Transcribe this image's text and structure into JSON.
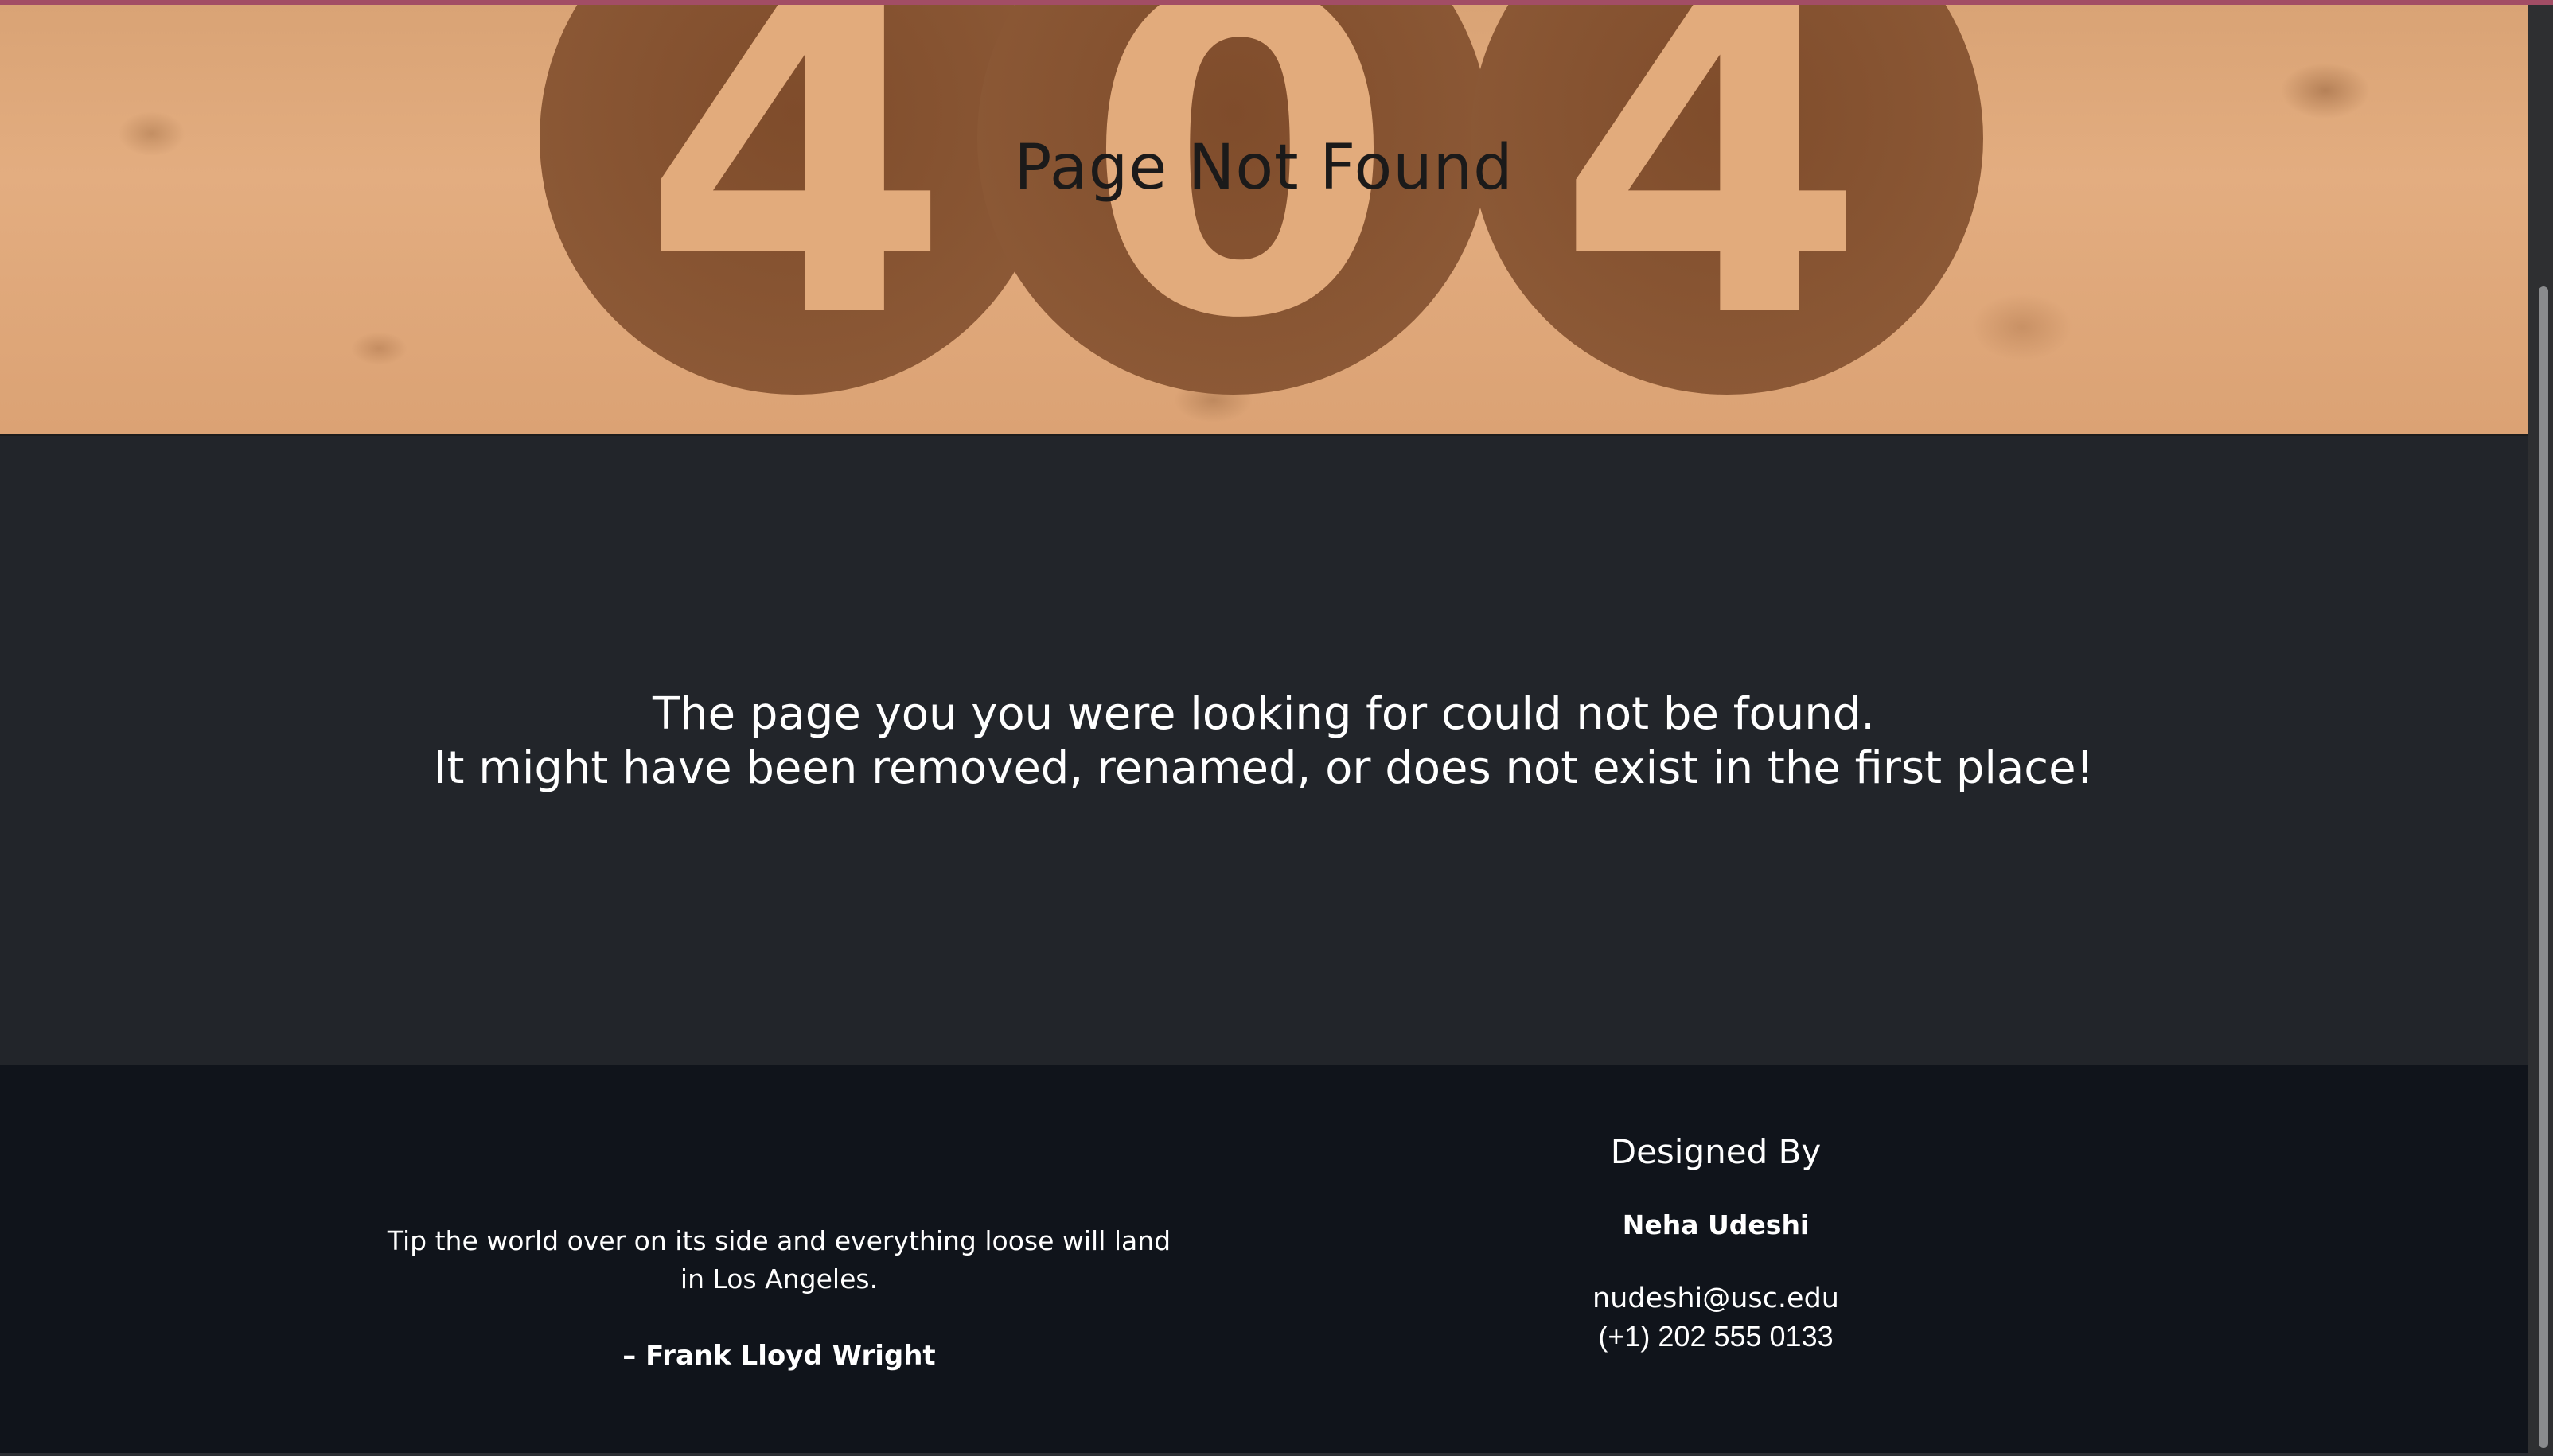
{
  "hero": {
    "title": "Page Not Found",
    "background_color": "#e3ad80",
    "art_digit_color": "#8a5532",
    "art_glyphs": [
      "4",
      "0",
      "4"
    ]
  },
  "main": {
    "message_line_1": "The page you you were looking for could not be found.",
    "message_line_2": "It might have been removed, renamed, or does not exist in the first place!",
    "background_color": "#22252a"
  },
  "footer": {
    "background_color": "#10141b",
    "quote_text": "Tip the world over on its side and everything loose will land in Los Angeles.",
    "quote_author": "– Frank Lloyd Wright",
    "designer_heading": "Designed By",
    "designer_name": "Neha Udeshi",
    "designer_email": "nudeshi@usc.edu",
    "designer_phone": "(+1) 202 555 0133"
  },
  "accent": {
    "top_stripe_color": "#a24d65"
  }
}
